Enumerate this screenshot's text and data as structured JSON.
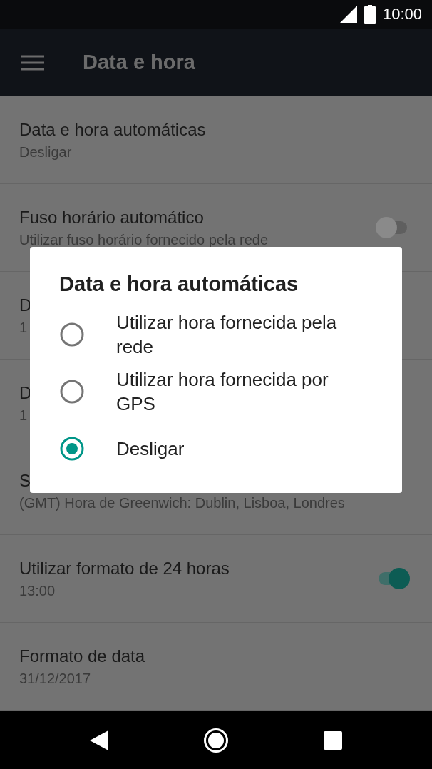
{
  "status_bar": {
    "time": "10:00"
  },
  "app_bar": {
    "title": "Data e hora"
  },
  "settings": [
    {
      "title": "Data e hora automáticas",
      "subtitle": "Desligar"
    },
    {
      "title": "Fuso horário automático",
      "subtitle": "Utilizar fuso horário fornecido pela rede",
      "on": false
    },
    {
      "title": "D",
      "subtitle": "1"
    },
    {
      "title": "D",
      "subtitle": "1"
    },
    {
      "title": "S",
      "subtitle": "(GMT) Hora de Greenwich: Dublin, Lisboa, Londres"
    },
    {
      "title": "Utilizar formato de 24 horas",
      "subtitle": "13:00",
      "on": true
    },
    {
      "title": "Formato de data",
      "subtitle": "31/12/2017"
    }
  ],
  "dialog": {
    "title": "Data e hora automáticas",
    "options": [
      {
        "label": "Utilizar hora fornecida pela rede",
        "selected": false
      },
      {
        "label": "Utilizar hora fornecida por GPS",
        "selected": false
      },
      {
        "label": "Desligar",
        "selected": true
      }
    ]
  }
}
